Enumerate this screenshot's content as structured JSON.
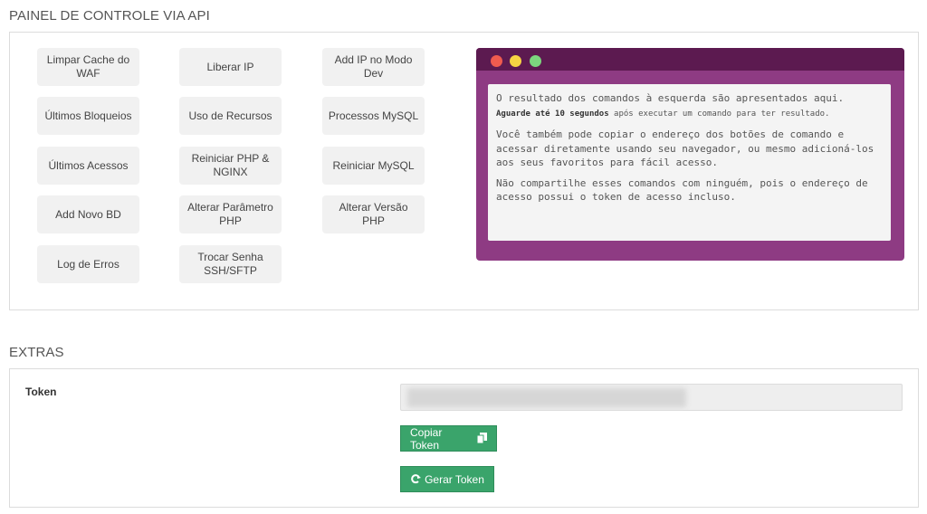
{
  "sections": {
    "painel_title": "PAINEL DE CONTROLE VIA API",
    "extras_title": "EXTRAS"
  },
  "commands": [
    {
      "label": "Limpar Cache do WAF"
    },
    {
      "label": "Liberar IP"
    },
    {
      "label": "Add IP no Modo Dev"
    },
    {
      "label": "Últimos Bloqueios"
    },
    {
      "label": "Uso de Recursos"
    },
    {
      "label": "Processos MySQL"
    },
    {
      "label": "Últimos Acessos"
    },
    {
      "label": "Reiniciar PHP & NGINX"
    },
    {
      "label": "Reiniciar MySQL"
    },
    {
      "label": "Add Novo BD"
    },
    {
      "label": "Alterar Parâmetro PHP"
    },
    {
      "label": "Alterar Versão PHP"
    },
    {
      "label": "Log de Erros"
    },
    {
      "label": "Trocar Senha SSH/SFTP"
    }
  ],
  "terminal": {
    "line1": "O resultado dos comandos à esquerda são apresentados aqui.",
    "wait_bold": "Aguarde até 10 segundos",
    "wait_rest": " após executar um comando para ter resultado.",
    "para2": "Você também pode copiar o endereço dos botões de comando e acessar diretamente usando seu navegador, ou mesmo adicioná-los aos seus favoritos para fácil acesso.",
    "para3": "Não compartilhe esses comandos com ninguém, pois o endereço de acesso possui o token de acesso incluso.",
    "colors": {
      "frame": "#8e3b83",
      "bar": "#5c1a50",
      "red": "#ef5b4f",
      "yellow": "#f6d443",
      "green": "#7cd67e"
    }
  },
  "extras": {
    "token_label": "Token",
    "copy_label": "Copiar Token",
    "copy_icon": "copy-icon",
    "generate_label": "Gerar Token",
    "generate_icon": "refresh-icon",
    "button_color": "#3aa46b"
  }
}
